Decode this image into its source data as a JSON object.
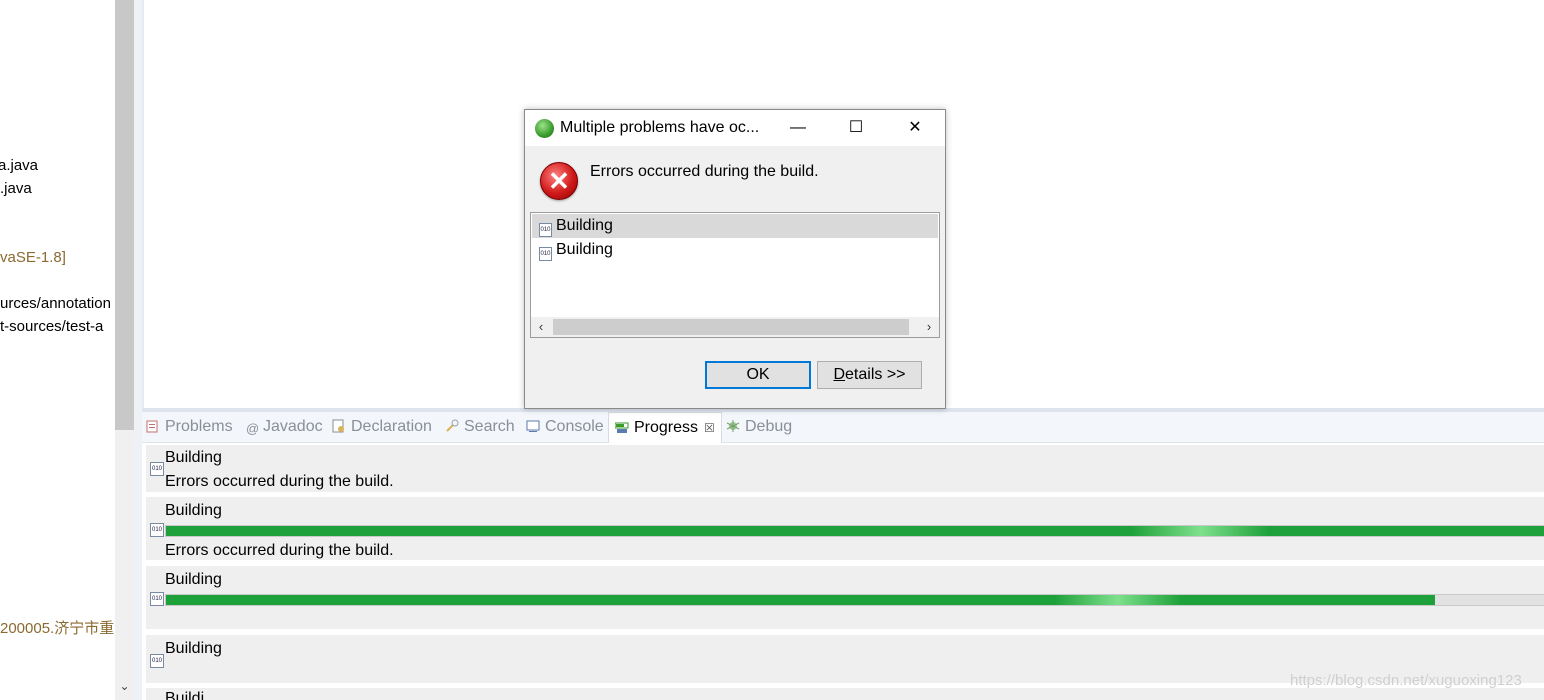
{
  "explorer": {
    "items": [
      {
        "text": "a.java",
        "kind": "file"
      },
      {
        "text": ".java",
        "kind": "file"
      },
      {
        "text": "vaSE-1.8]",
        "kind": "lib"
      },
      {
        "text": "urces/annotation",
        "kind": "file"
      },
      {
        "text": "t-sources/test-a",
        "kind": "file"
      },
      {
        "text": "200005.济宁市重",
        "kind": "lib"
      }
    ],
    "scroll_down_icon": "chevron-down-icon"
  },
  "views": {
    "tabs": [
      {
        "label": "Problems",
        "icon": "problems-icon",
        "active": false
      },
      {
        "label": "Javadoc",
        "icon": "javadoc-icon",
        "active": false
      },
      {
        "label": "Declaration",
        "icon": "declaration-icon",
        "active": false
      },
      {
        "label": "Search",
        "icon": "search-icon",
        "active": false
      },
      {
        "label": "Console",
        "icon": "console-icon",
        "active": false
      },
      {
        "label": "Progress",
        "icon": "progress-icon",
        "active": true
      },
      {
        "label": "Debug",
        "icon": "debug-icon",
        "active": false
      }
    ],
    "close_glyph": "☒"
  },
  "progress": {
    "entries": [
      {
        "title": "Building",
        "message": "Errors occurred during the build.",
        "fraction": null
      },
      {
        "title": "Building",
        "message": "Errors occurred during the build.",
        "fraction": 1.0
      },
      {
        "title": "Building",
        "message": "",
        "fraction": 0.92
      },
      {
        "title": "Building",
        "message": "",
        "fraction": null
      },
      {
        "title": "Buildi",
        "message": "",
        "fraction": null
      }
    ],
    "bar_color": "#1ea03a"
  },
  "watermark": "https://blog.csdn.net/xuguoxing123",
  "dialog": {
    "title": "Multiple problems have oc...",
    "minimize": "—",
    "maximize": "☐",
    "close": "✕",
    "error_icon": "error-icon",
    "message": "Errors occurred during the build.",
    "list": [
      "Building",
      "Building"
    ],
    "ok_label": "OK",
    "details_label": "Details >>",
    "details_mnemonic": "D"
  }
}
